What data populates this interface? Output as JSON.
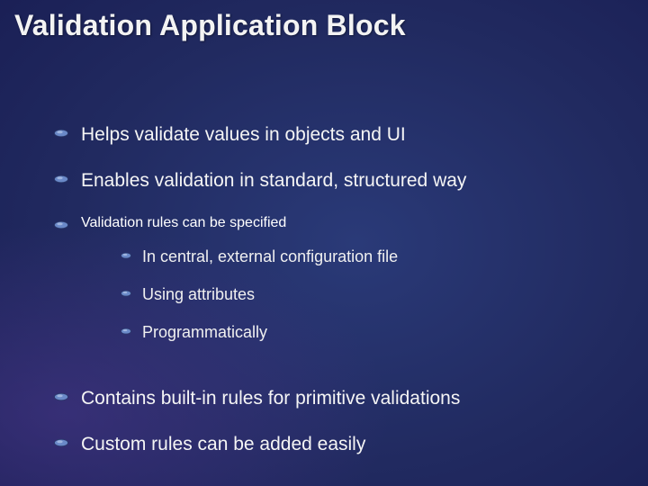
{
  "title": "Validation Application Block",
  "bullets": [
    {
      "text": "Helps validate values in objects and UI"
    },
    {
      "text": "Enables validation in standard, structured way"
    },
    {
      "text": "Validation rules can be specified",
      "sub": [
        {
          "text": "In central, external configuration file"
        },
        {
          "text": "Using attributes"
        },
        {
          "text": "Programmatically"
        }
      ]
    },
    {
      "text": "Contains built-in rules for primitive validations"
    },
    {
      "text": "Custom rules can be added easily"
    }
  ]
}
